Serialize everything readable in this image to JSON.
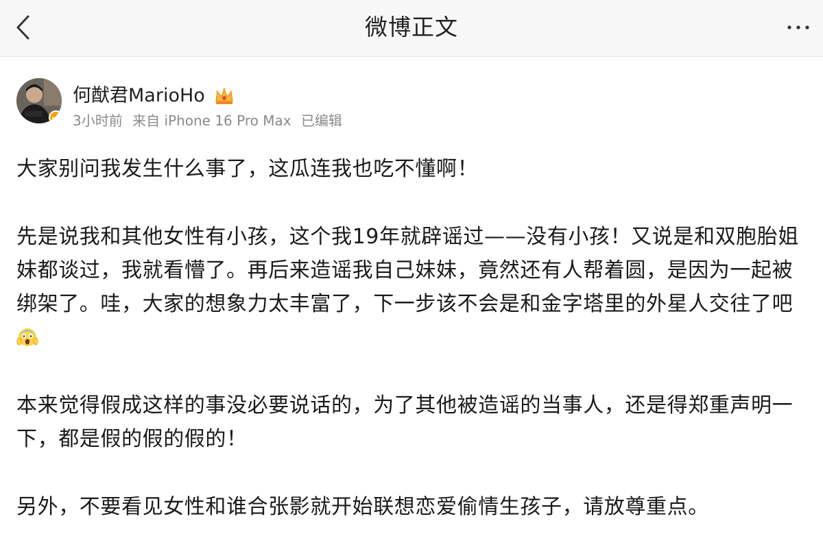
{
  "navbar": {
    "title": "微博正文",
    "back_icon": "chevron-left-icon",
    "more_icon": "more-horizontal-icon"
  },
  "post": {
    "author": {
      "name": "何猷君MarioHo",
      "crown_icon": "vip-crown-icon",
      "verified_badge_color": "#f7a300"
    },
    "meta": {
      "time": "3小时前",
      "source": "来自 iPhone 16 Pro Max",
      "edited": "已编辑"
    },
    "paragraphs": [
      "大家别问我发生什么事了，这瓜连我也吃不懂啊！",
      "先是说我和其他女性有小孩，这个我19年就辟谣过——没有小孩！又说是和双胞胎姐妹都谈过，我就看懵了。再后来造谣我自己妹妹，竟然还有人帮着圆，是因为一起被绑架了。哇，大家的想象力太丰富了，下一步该不会是和金字塔里的外星人交往了吧",
      "本来觉得假成这样的事没必要说话的，为了其他被造谣的当事人，还是得郑重声明一下，都是假的假的假的！",
      "另外，不要看见女性和谁合张影就开始联想恋爱偷情生孩子，请放尊重点。"
    ],
    "inline_emoji": "face-screaming-in-fear-icon"
  }
}
